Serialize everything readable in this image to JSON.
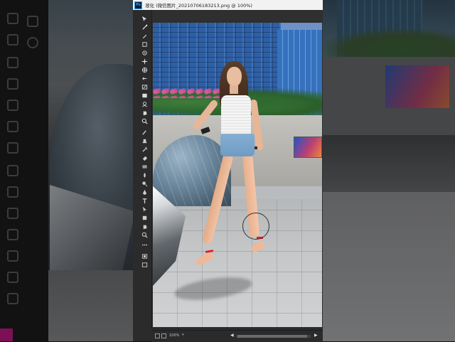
{
  "window": {
    "title": "液化 (微信图片_20210706183213.png @ 100%)"
  },
  "tools": [
    "move-tool-icon",
    "forward-warp-icon",
    "reconstruct-icon",
    "smooth-icon",
    "twirl-icon",
    "pucker-icon",
    "bloat-icon",
    "push-left-icon",
    "freeze-mask-icon",
    "thaw-mask-icon",
    "face-tool-icon",
    "hand-tool-icon",
    "zoom-tool-icon"
  ],
  "status": {
    "zoom": "100%"
  },
  "colors": {
    "foreground": "#e020d8",
    "background": "#ffffff",
    "app_bg": "#2b2b2b",
    "title_bar": "#f2f2f2"
  }
}
